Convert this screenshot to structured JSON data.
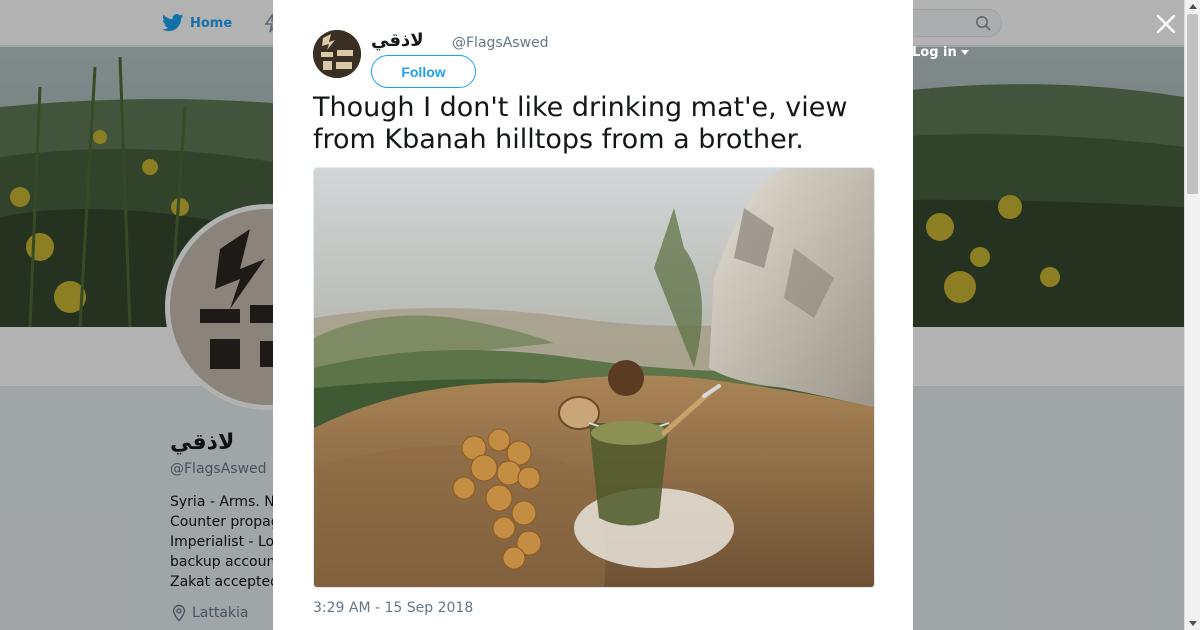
{
  "header": {
    "home_label": "Home",
    "login_label": "Log in",
    "search_placeholder": ""
  },
  "profile": {
    "name": "لاذقي",
    "handle": "@FlagsAswed",
    "bio_lines": [
      "Syria - Arms. N",
      "Counter propag",
      "Imperialist - Lo",
      "backup accoun",
      "Zakat accepted"
    ],
    "location": "Lattakia"
  },
  "tweet": {
    "author_name": "لاذقي",
    "author_handle": "@FlagsAswed",
    "follow_label": "Follow",
    "text": "Though I don't like drinking mat'e, view from Kbanah hilltops from a brother.",
    "timestamp": "3:29 AM - 15 Sep 2018"
  },
  "colors": {
    "accent": "#1da1f2",
    "text_primary": "#14171a",
    "text_secondary": "#657786"
  },
  "icons": {
    "nav_home": "bird-icon",
    "nav_moments": "lightning-icon",
    "search": "search-icon",
    "close": "close-icon",
    "location": "pin-icon",
    "login_menu": "caret-down-icon"
  }
}
